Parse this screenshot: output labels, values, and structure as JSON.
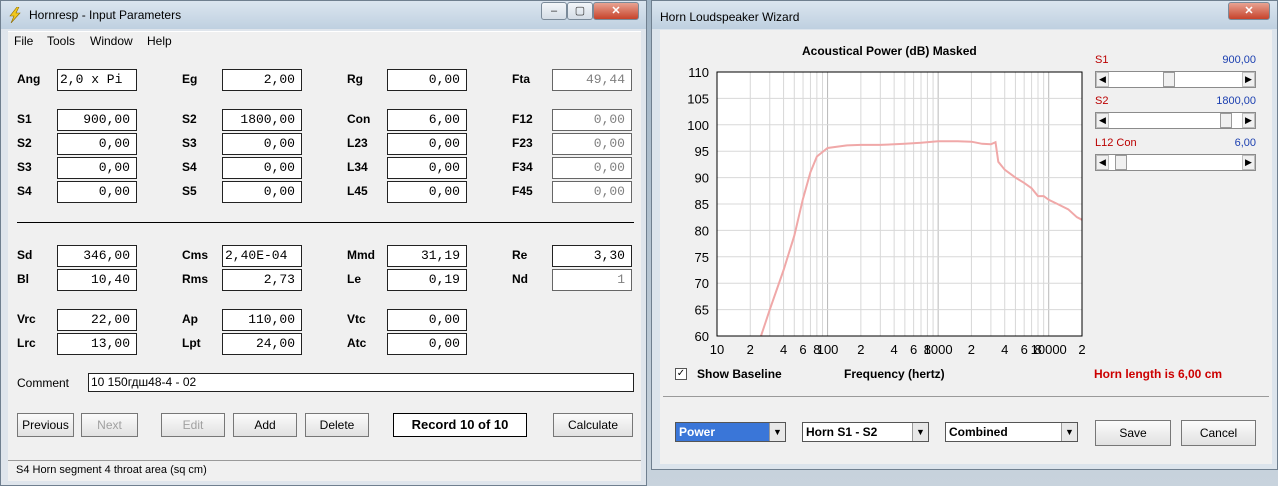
{
  "left_window": {
    "title": "Hornresp - Input Parameters",
    "menu": [
      "File",
      "Tools",
      "Window",
      "Help"
    ],
    "params_top": [
      {
        "label": "Ang",
        "value": "2,0 x Pi"
      },
      {
        "label": "Eg",
        "value": "2,00"
      },
      {
        "label": "Rg",
        "value": "0,00"
      },
      {
        "label": "Fta",
        "value": "49,44"
      },
      {
        "label": "S1",
        "value": "900,00"
      },
      {
        "label": "S2",
        "value": "1800,00"
      },
      {
        "label": "Con",
        "value": "6,00"
      },
      {
        "label": "F12",
        "value": "0,00"
      },
      {
        "label": "S2",
        "value": "0,00"
      },
      {
        "label": "S3",
        "value": "0,00"
      },
      {
        "label": "L23",
        "value": "0,00"
      },
      {
        "label": "F23",
        "value": "0,00"
      },
      {
        "label": "S3",
        "value": "0,00"
      },
      {
        "label": "S4",
        "value": "0,00"
      },
      {
        "label": "L34",
        "value": "0,00"
      },
      {
        "label": "F34",
        "value": "0,00"
      },
      {
        "label": "S4",
        "value": "0,00"
      },
      {
        "label": "S5",
        "value": "0,00"
      },
      {
        "label": "L45",
        "value": "0,00"
      },
      {
        "label": "F45",
        "value": "0,00"
      }
    ],
    "params_driver": [
      {
        "label": "Sd",
        "value": "346,00"
      },
      {
        "label": "Cms",
        "value": "2,40E-04"
      },
      {
        "label": "Mmd",
        "value": "31,19"
      },
      {
        "label": "Re",
        "value": "3,30"
      },
      {
        "label": "Bl",
        "value": "10,40"
      },
      {
        "label": "Rms",
        "value": "2,73"
      },
      {
        "label": "Le",
        "value": "0,19"
      },
      {
        "label": "Nd",
        "value": "1"
      }
    ],
    "params_chamber": [
      {
        "label": "Vrc",
        "value": "22,00"
      },
      {
        "label": "Ap",
        "value": "110,00"
      },
      {
        "label": "Vtc",
        "value": "0,00"
      },
      {
        "label": "Lrc",
        "value": "13,00"
      },
      {
        "label": "Lpt",
        "value": "24,00"
      },
      {
        "label": "Atc",
        "value": "0,00"
      }
    ],
    "comment_label": "Comment",
    "comment_value": "10 150гдш48-4 - 02",
    "buttons": {
      "previous": "Previous",
      "next": "Next",
      "edit": "Edit",
      "add": "Add",
      "delete": "Delete",
      "calculate": "Calculate"
    },
    "record": "Record 10 of 10",
    "status": "S4   Horn segment 4 throat area  (sq cm)"
  },
  "right_window": {
    "title": "Horn Loudspeaker Wizard",
    "chart_title": "Acoustical Power (dB)   Masked",
    "x_axis_label": "Frequency (hertz)",
    "show_baseline_label": "Show Baseline",
    "show_baseline_checked": true,
    "sliders": [
      {
        "label": "S1",
        "value": "900,00",
        "position": 0.45
      },
      {
        "label": "S2",
        "value": "1800,00",
        "position": 0.92
      },
      {
        "label": "L12  Con",
        "value": "6,00",
        "position": 0.05
      }
    ],
    "horn_length": "Horn length is 6,00 cm",
    "combos": [
      "Power",
      "Horn S1 - S2",
      "Combined"
    ],
    "save_label": "Save",
    "cancel_label": "Cancel"
  },
  "chart_data": {
    "type": "line",
    "title": "Acoustical Power (dB)   Masked",
    "xlabel": "Frequency (hertz)",
    "ylabel": "",
    "x_scale": "log",
    "xlim": [
      10,
      20000
    ],
    "ylim": [
      60,
      110
    ],
    "y_ticks": [
      "110",
      "105",
      "100",
      "95",
      "90",
      "85",
      "80",
      "75",
      "70",
      "65",
      "60"
    ],
    "x_ticks": [
      "10",
      "2",
      "4",
      "6",
      "8",
      "100",
      "2",
      "4",
      "6",
      "8",
      "1000",
      "2",
      "4",
      "6",
      "8",
      "10000",
      "2"
    ],
    "series_color": "#f0a8a8",
    "series": [
      {
        "points": [
          [
            25,
            60
          ],
          [
            30,
            65
          ],
          [
            40,
            72.5
          ],
          [
            50,
            79
          ],
          [
            60,
            86
          ],
          [
            70,
            91
          ],
          [
            80,
            94
          ],
          [
            100,
            95.6
          ],
          [
            150,
            96.1
          ],
          [
            200,
            96.2
          ],
          [
            300,
            96.2
          ],
          [
            500,
            96.4
          ],
          [
            700,
            96.6
          ],
          [
            1000,
            96.9
          ],
          [
            1500,
            96.9
          ],
          [
            2000,
            96.8
          ],
          [
            2500,
            96.4
          ],
          [
            3000,
            96.3
          ],
          [
            3300,
            96.7
          ],
          [
            3500,
            93
          ],
          [
            4000,
            91.5
          ],
          [
            5000,
            90
          ],
          [
            6000,
            89
          ],
          [
            7000,
            88
          ],
          [
            8000,
            86.5
          ],
          [
            9000,
            86.5
          ],
          [
            10000,
            85.8
          ],
          [
            12000,
            85
          ],
          [
            15000,
            84
          ],
          [
            18000,
            82.5
          ],
          [
            20000,
            82
          ]
        ]
      }
    ]
  }
}
